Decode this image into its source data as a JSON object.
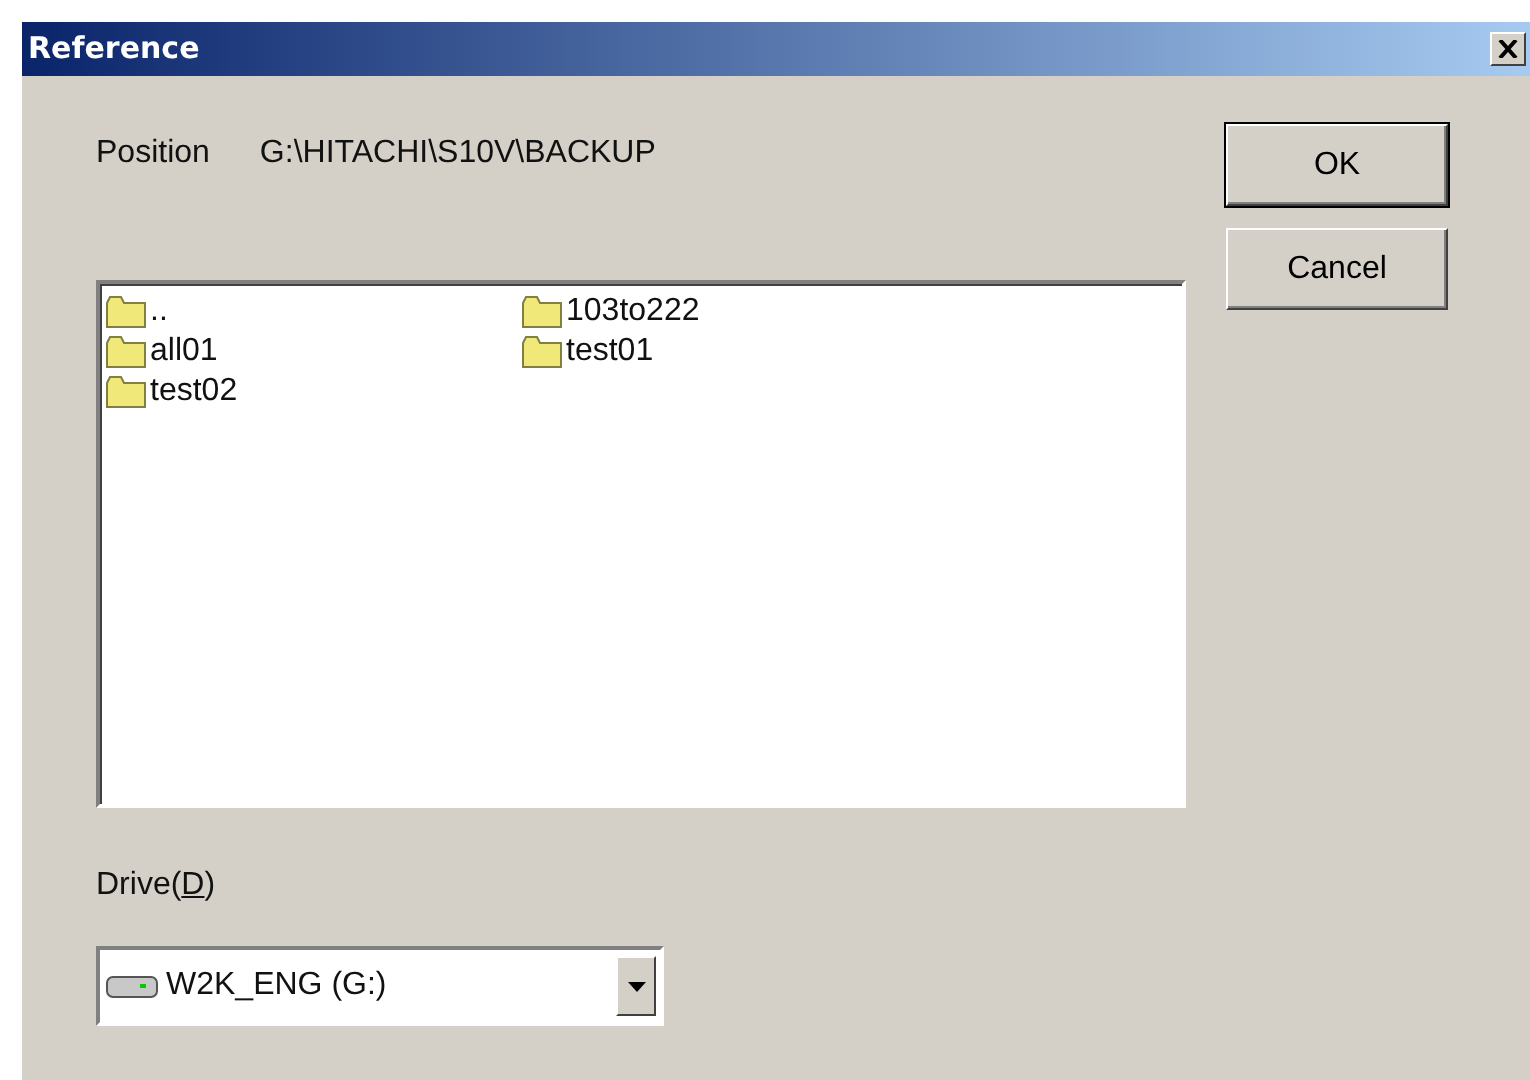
{
  "window": {
    "title": "Reference"
  },
  "position": {
    "label": "Position",
    "value": "G:\\HITACHI\\S10V\\BACKUP"
  },
  "buttons": [
    {
      "label": "OK",
      "default": true
    },
    {
      "label": "Cancel",
      "default": false
    }
  ],
  "folder_list": {
    "columns": [
      [
        {
          "name": ".."
        },
        {
          "name": "all01"
        },
        {
          "name": "test02"
        }
      ],
      [
        {
          "name": "103to222"
        },
        {
          "name": "test01"
        }
      ]
    ]
  },
  "drive": {
    "label_before": "Drive(",
    "mnemonic": "D",
    "label_after": ")",
    "value": "W2K_ENG (G:)"
  }
}
